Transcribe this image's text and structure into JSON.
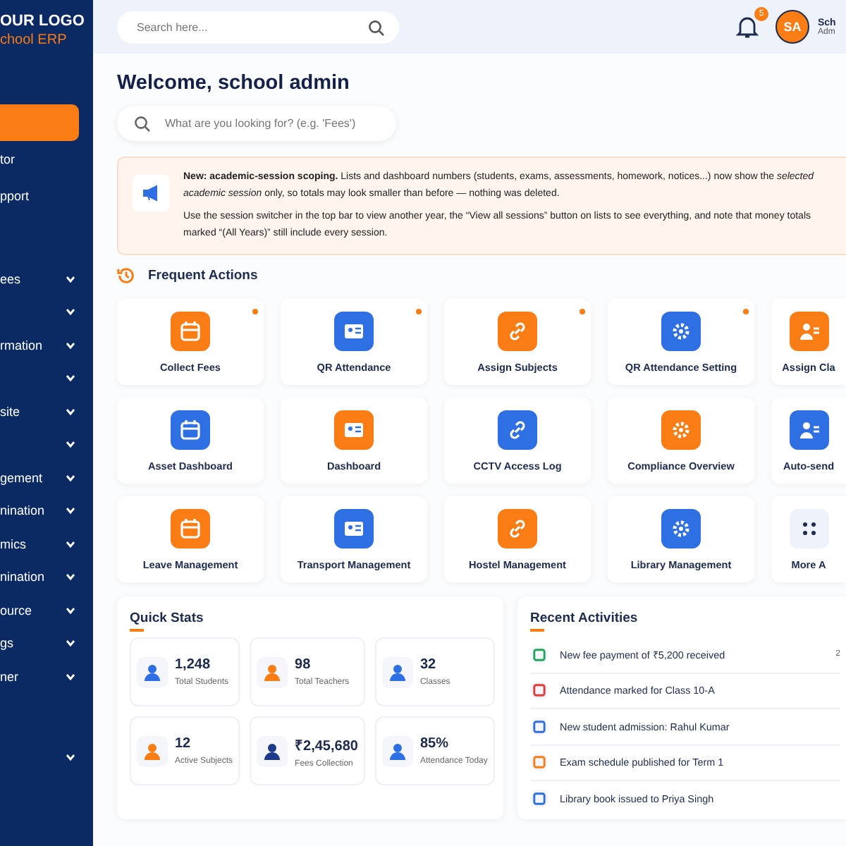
{
  "sidebar": {
    "logo_title": "OUR LOGO",
    "logo_subtitle": "chool ERP",
    "sections": [
      {
        "items": [
          {
            "selected": true,
            "expandable": false
          },
          {
            "label": "tor",
            "selected": false,
            "expandable": false
          },
          {
            "label": "pport",
            "selected": false,
            "expandable": false
          }
        ]
      },
      {
        "items": [
          {
            "label": "ees",
            "selected": false,
            "expandable": true
          },
          {
            "selected": false,
            "expandable": true
          },
          {
            "label": "rmation",
            "selected": false,
            "expandable": true
          },
          {
            "selected": false,
            "expandable": true
          },
          {
            "label": "site",
            "selected": false,
            "expandable": true
          },
          {
            "selected": false,
            "expandable": true
          },
          {
            "label": "gement",
            "selected": false,
            "expandable": true
          },
          {
            "label": "nination",
            "selected": false,
            "expandable": true
          },
          {
            "label": "mics",
            "selected": false,
            "expandable": true
          },
          {
            "label": "nination",
            "selected": false,
            "expandable": true
          },
          {
            "label": "ource",
            "selected": false,
            "expandable": true
          },
          {
            "label": "gs",
            "selected": false,
            "expandable": true
          },
          {
            "label": "ner",
            "selected": false,
            "expandable": true
          }
        ]
      },
      {
        "items": [
          {
            "selected": false,
            "expandable": true
          }
        ]
      }
    ]
  },
  "topbar": {
    "search": {
      "placeholder": "Search here..."
    },
    "notifications": "5",
    "avatar": "SA",
    "user_name": "Sch",
    "user_role": "Adm"
  },
  "welcome": "Welcome, school admin",
  "quick_search": {
    "placeholder": "What are you looking for? (e.g. 'Fees')"
  },
  "notice": {
    "paragraphs": [
      "**New: academic-session scoping.** Lists and dashboard numbers (students, exams, assessments, homework, notices...) now show the *selected academic session* only, so totals may look smaller than before — nothing was deleted.",
      "Use the session switcher in the top bar to view another year, the “View all sessions” button on lists to see everything, and note that money totals marked “(All Years)” still include every session."
    ]
  },
  "frequent_actions": {
    "title": "Frequent Actions",
    "items": [
      {
        "label": "Collect Fees",
        "color": "#f97c14",
        "badge": true
      },
      {
        "label": "QR Attendance",
        "color": "#2f6fe4",
        "badge": true
      },
      {
        "label": "Assign Subjects",
        "color": "#f97c14",
        "badge": true
      },
      {
        "label": "QR Attendance Setting",
        "color": "#2f6fe4",
        "badge": true
      },
      {
        "label": "Assign Cla",
        "color": "#f97c14",
        "badge": false
      },
      {
        "label": "Asset Dashboard",
        "color": "#2f6fe4",
        "badge": false
      },
      {
        "label": "Dashboard",
        "color": "#f97c14",
        "badge": false
      },
      {
        "label": "CCTV Access Log",
        "color": "#2f6fe4",
        "badge": false
      },
      {
        "label": "Compliance Overview",
        "color": "#f97c14",
        "badge": false
      },
      {
        "label": "Auto-send",
        "color": "#2f6fe4",
        "badge": false
      },
      {
        "label": "Leave Management",
        "color": "#f97c14",
        "badge": false
      },
      {
        "label": "Transport Management",
        "color": "#2f6fe4",
        "badge": false
      },
      {
        "label": "Hostel Management",
        "color": "#f97c14",
        "badge": false
      },
      {
        "label": "Library Management",
        "color": "#2f6fe4",
        "badge": false
      },
      {
        "label": "More A",
        "color": "#eef2fb",
        "badge": false
      }
    ]
  },
  "quick_stats": {
    "title": "Quick Stats",
    "items": [
      {
        "value": "1,248",
        "label": "Total Students",
        "color": "#2f6fe4"
      },
      {
        "value": "98",
        "label": "Total Teachers",
        "color": "#f97c14"
      },
      {
        "value": "32",
        "label": "Classes",
        "color": "#2f6fe4"
      },
      {
        "value": "12",
        "label": "Active Subjects",
        "color": "#f97c14"
      },
      {
        "value": "₹2,45,680",
        "label": "Fees Collection",
        "color": "#1e3a8a"
      },
      {
        "value": "85%",
        "label": "Attendance Today",
        "color": "#2f6fe4"
      }
    ]
  },
  "recent_activities": {
    "title": "Recent Activities",
    "items": [
      {
        "text": "New fee payment of ₹5,200 received",
        "time": "2",
        "color": "#22a55b"
      },
      {
        "text": "Attendance marked for Class 10-A",
        "color": "#e53935"
      },
      {
        "text": "New student admission: Rahul Kumar",
        "color": "#2f6fe4"
      },
      {
        "text": "Exam schedule published for Term 1",
        "color": "#f97c14"
      },
      {
        "text": "Library book issued to Priya Singh",
        "color": "#2f6fe4"
      }
    ]
  }
}
